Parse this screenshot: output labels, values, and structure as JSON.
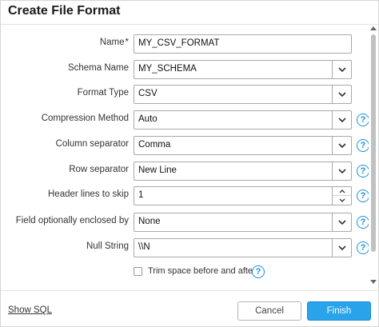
{
  "dialog": {
    "title": "Create File Format"
  },
  "fields": {
    "name": {
      "label": "Name",
      "required_mark": "*",
      "value": "MY_CSV_FORMAT"
    },
    "schema_name": {
      "label": "Schema Name",
      "value": "MY_SCHEMA"
    },
    "format_type": {
      "label": "Format Type",
      "value": "CSV"
    },
    "compression_method": {
      "label": "Compression Method",
      "value": "Auto"
    },
    "column_separator": {
      "label": "Column separator",
      "value": "Comma"
    },
    "row_separator": {
      "label": "Row separator",
      "value": "New Line"
    },
    "header_lines_to_skip": {
      "label": "Header lines to skip",
      "value": "1"
    },
    "field_optionally_enclosed_by": {
      "label": "Field optionally enclosed by",
      "value": "None"
    },
    "null_string": {
      "label": "Null String",
      "value": "\\\\N"
    },
    "trim_space": {
      "label": "Trim space before and after",
      "checked": false
    }
  },
  "help_glyph": "?",
  "footer": {
    "show_sql": "Show SQL",
    "cancel": "Cancel",
    "finish": "Finish"
  },
  "colors": {
    "accent": "#29a3ea",
    "help": "#1e90d6"
  },
  "icons": [
    "chevron-down-icon",
    "spinner-up-icon",
    "spinner-down-icon",
    "help-icon"
  ]
}
